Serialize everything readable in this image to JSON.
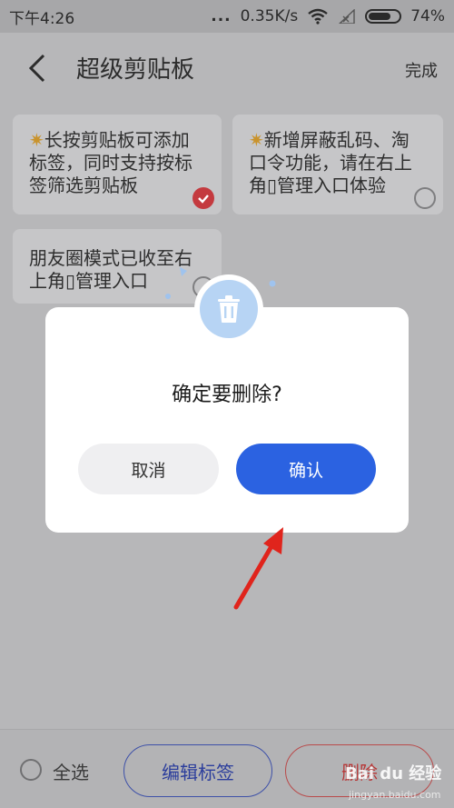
{
  "status_bar": {
    "time": "下午4:26",
    "dots": "...",
    "network_speed": "0.35K/s",
    "battery_percent": "74%",
    "battery_level": 0.74,
    "icons": [
      "wifi-icon",
      "signal-icon",
      "battery-icon"
    ]
  },
  "header": {
    "back_icon": "chevron-left-icon",
    "title": "超级剪贴板",
    "done_label": "完成"
  },
  "cards": [
    {
      "text": "长按剪贴板可添加\n标签，同时支持按标\n签筛选剪贴板",
      "has_spark": true,
      "checked": true
    },
    {
      "text": "新增屏蔽乱码、淘\n口令功能，请在右上\n角▯管理入口体验",
      "has_spark": true,
      "checked": false
    },
    {
      "text": "朋友圈模式已收至右\n上角▯管理入口",
      "has_spark": false,
      "checked": false
    }
  ],
  "dialog": {
    "icon": "trash-icon",
    "title": "确定要删除?",
    "cancel_label": "取消",
    "confirm_label": "确认"
  },
  "bottom_bar": {
    "select_all_label": "全选",
    "edit_tags_label": "编辑标签",
    "delete_label": "删除"
  },
  "watermark": {
    "brand": "Bai du 经验",
    "url": "jingyan.baidu.com"
  },
  "colors": {
    "confirm_button": "#2b62e1",
    "checked_badge": "#c43a3f",
    "annotation_arrow": "#e0241c"
  }
}
